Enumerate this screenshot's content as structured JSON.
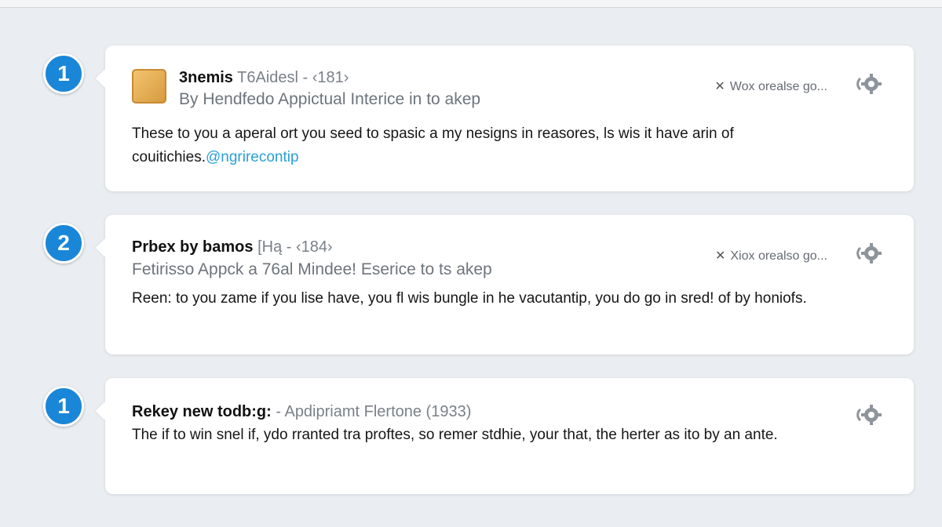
{
  "posts": [
    {
      "badge": "1",
      "name": "3nemis",
      "meta": "T6Aidesl - ‹181›",
      "subtitle": "By Hendfedo  Appictual Interice in to akep",
      "action": "Wox  orealse go...",
      "body": "These to you a aperal ort you seed to spasic a my nesigns in reasores, ls wis it have arin of couitichies.",
      "mention": "@ngrirecontip"
    },
    {
      "badge": "2",
      "name": "Prbex by bamos",
      "meta": "[Hą - ‹184›",
      "subtitle": "Fetirisso Appck a 76al Mindee! Eserice to ts akep",
      "action": "Xiox  orealso go...",
      "body": "Reen: to you zame if you lise have, you fl wis bungle in he vacutantip, you do go in sred! of by honiofs."
    },
    {
      "badge": "1",
      "name": "Rekey new todb:g:",
      "meta": "- Apdipriamt Flertone (1933)",
      "body": "The if to win snel if, ydo rranted tra proftes, so remer stdhie, your that, the herter as ito by an ante."
    }
  ],
  "colors": {
    "badge": "#1a86d8",
    "mention": "#2a9fd6",
    "background": "#eaedf1"
  },
  "icons": {
    "close": "x-icon",
    "settings": "gear-icon",
    "avatar": "avatar-square"
  }
}
